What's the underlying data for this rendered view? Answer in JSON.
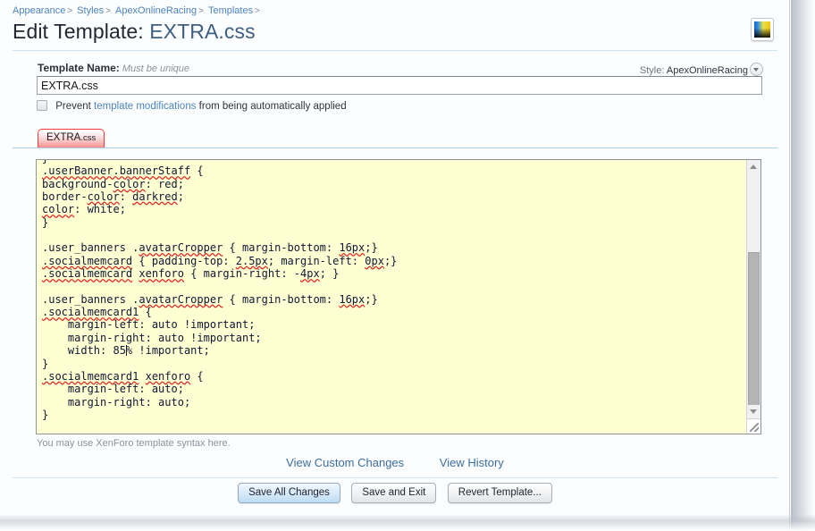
{
  "breadcrumb": {
    "items": [
      "Appearance",
      "Styles",
      "ApexOnlineRacing",
      "Templates"
    ],
    "separator": ">"
  },
  "header": {
    "title_prefix": "Edit Template:",
    "title_name": "EXTRA.css",
    "swatch_icon": "color-gradient-swatch-icon"
  },
  "form": {
    "template_name_label": "Template Name:",
    "template_name_hint": "Must be unique",
    "template_name_value": "EXTRA.css",
    "style_label": "Style:",
    "style_value": "ApexOnlineRacing",
    "style_caret_icon": "chevron-down-icon",
    "prevent_text_before": "Prevent",
    "prevent_link": "template modifications",
    "prevent_text_after": "from being automatically applied",
    "prevent_checked": false
  },
  "tabs": [
    {
      "label_main": "EXTRA",
      "label_ext": ".css",
      "active": true
    }
  ],
  "editor": {
    "code": ".userBanner.bannerStaff {\nbackground-color: red;\nborder-color: darkred;\ncolor: white;\n}\n\n.user_banners .avatarCropper { margin-bottom: 16px;}\n.socialmemcard { padding-top: 2.5px; margin-left: 0px;}\n.socialmemcard xenforo { margin-right: -4px; }\n\n.user_banners .avatarCropper { margin-bottom: 16px;}\n.socialmemcard1 {\n    margin-left: auto !important;\n    margin-right: auto !important;\n    width: 85% !important;\n}\n.socialmemcard1 xenforo {\n    margin-left: auto;\n    margin-right: auto;\n}",
    "clipped_first_line": "}",
    "background_color": "#ffffd4",
    "text_color": "#101733",
    "spellcheck_underline_color": "#e02020",
    "caret_line": "    width: 85|% !important;",
    "scrollbar": {
      "up_icon": "scroll-up-arrow-icon",
      "down_icon": "scroll-down-arrow-icon",
      "resize_grip_icon": "resize-grip-icon"
    }
  },
  "syntax_note": "You may use XenForo template syntax here.",
  "view_links": [
    {
      "label": "View Custom Changes"
    },
    {
      "label": "View History"
    }
  ],
  "buttons": [
    {
      "label": "Save All Changes",
      "primary": true
    },
    {
      "label": "Save and Exit",
      "primary": false
    },
    {
      "label": "Revert Template...",
      "primary": false
    }
  ]
}
